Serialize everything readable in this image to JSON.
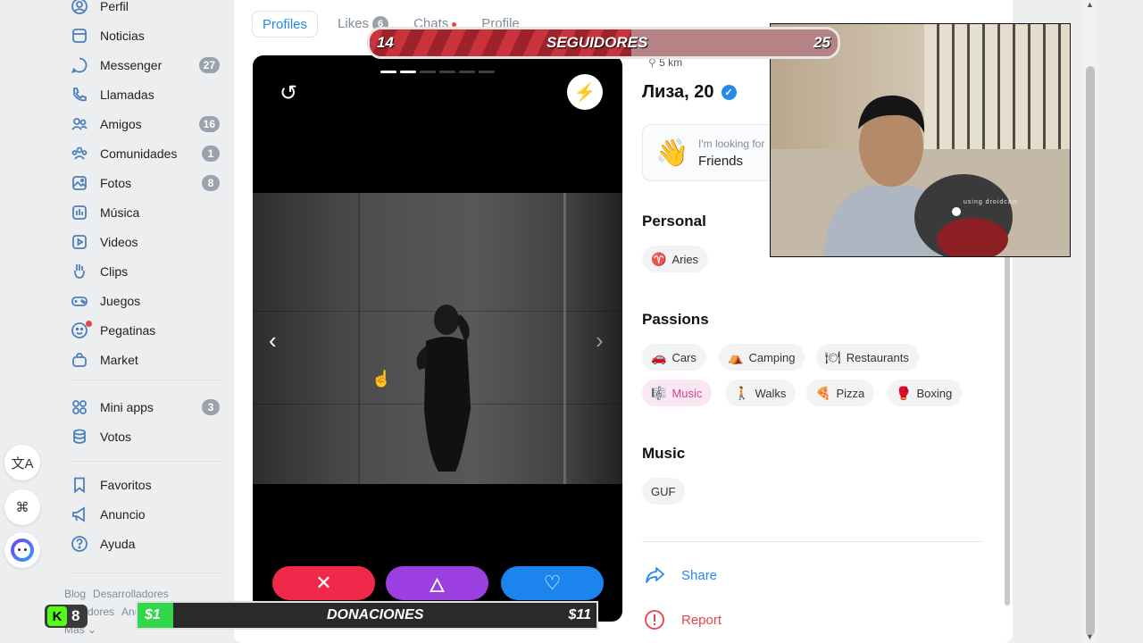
{
  "sidebar": {
    "items": [
      {
        "label": "Perfil",
        "icon": "user-circle-icon"
      },
      {
        "label": "Noticias",
        "icon": "news-icon"
      },
      {
        "label": "Messenger",
        "icon": "message-icon",
        "badge": "27"
      },
      {
        "label": "Llamadas",
        "icon": "phone-icon"
      },
      {
        "label": "Amigos",
        "icon": "friends-icon",
        "badge": "16"
      },
      {
        "label": "Comunidades",
        "icon": "communities-icon",
        "badge": "1"
      },
      {
        "label": "Fotos",
        "icon": "photo-icon",
        "badge": "8"
      },
      {
        "label": "Música",
        "icon": "music-icon"
      },
      {
        "label": "Videos",
        "icon": "video-icon"
      },
      {
        "label": "Clips",
        "icon": "clips-icon"
      },
      {
        "label": "Juegos",
        "icon": "gamepad-icon"
      },
      {
        "label": "Pegatinas",
        "icon": "sticker-icon"
      },
      {
        "label": "Market",
        "icon": "bag-icon"
      },
      {
        "label": "Mini apps",
        "icon": "apps-icon",
        "badge": "3"
      },
      {
        "label": "Votos",
        "icon": "coins-icon"
      },
      {
        "label": "Favoritos",
        "icon": "bookmark-icon"
      },
      {
        "label": "Anuncio",
        "icon": "megaphone-icon"
      },
      {
        "label": "Ayuda",
        "icon": "help-icon"
      }
    ],
    "footer": {
      "blog": "Blog",
      "devs": "Desarrolladores",
      "creators": "Creadores",
      "ads": "Anuncios de VK",
      "more": "Más"
    }
  },
  "tabs": {
    "profiles": "Profiles",
    "likes": "Likes",
    "likes_badge": "6",
    "chats": "Chats",
    "profile": "Profile"
  },
  "profile": {
    "distance": "5 km",
    "name": "Лиза, 20",
    "looking_label": "I'm looking for",
    "looking_value": "Friends",
    "personal_title": "Personal",
    "zodiac": "Aries",
    "passions_title": "Passions",
    "passions": [
      {
        "label": "Cars",
        "icon": "🚗"
      },
      {
        "label": "Camping",
        "icon": "⛺"
      },
      {
        "label": "Restaurants",
        "icon": "🍽"
      },
      {
        "label": "Music",
        "icon": "🎼",
        "highlight": true
      },
      {
        "label": "Walks",
        "icon": "🚶"
      },
      {
        "label": "Pizza",
        "icon": "🍕"
      },
      {
        "label": "Boxing",
        "icon": "🥊"
      }
    ],
    "music_title": "Music",
    "music_artist": "GUF",
    "share": "Share",
    "report": "Report"
  },
  "photo_progress": {
    "total": 6,
    "current": 2
  },
  "overlay": {
    "followers_current": "14",
    "followers_label": "SEGUIDORES",
    "followers_goal": "25",
    "followers_progress": 0.56,
    "donations_current": "$1",
    "donations_label": "DONACIONES",
    "donations_goal": "$11",
    "kick_count": "8",
    "cam_text": "using droidcam"
  },
  "colors": {
    "accent": "#2688eb",
    "dislike": "#f0284a",
    "superlike": "#9b3fe0",
    "like": "#1b84ef",
    "report": "#e64646"
  }
}
